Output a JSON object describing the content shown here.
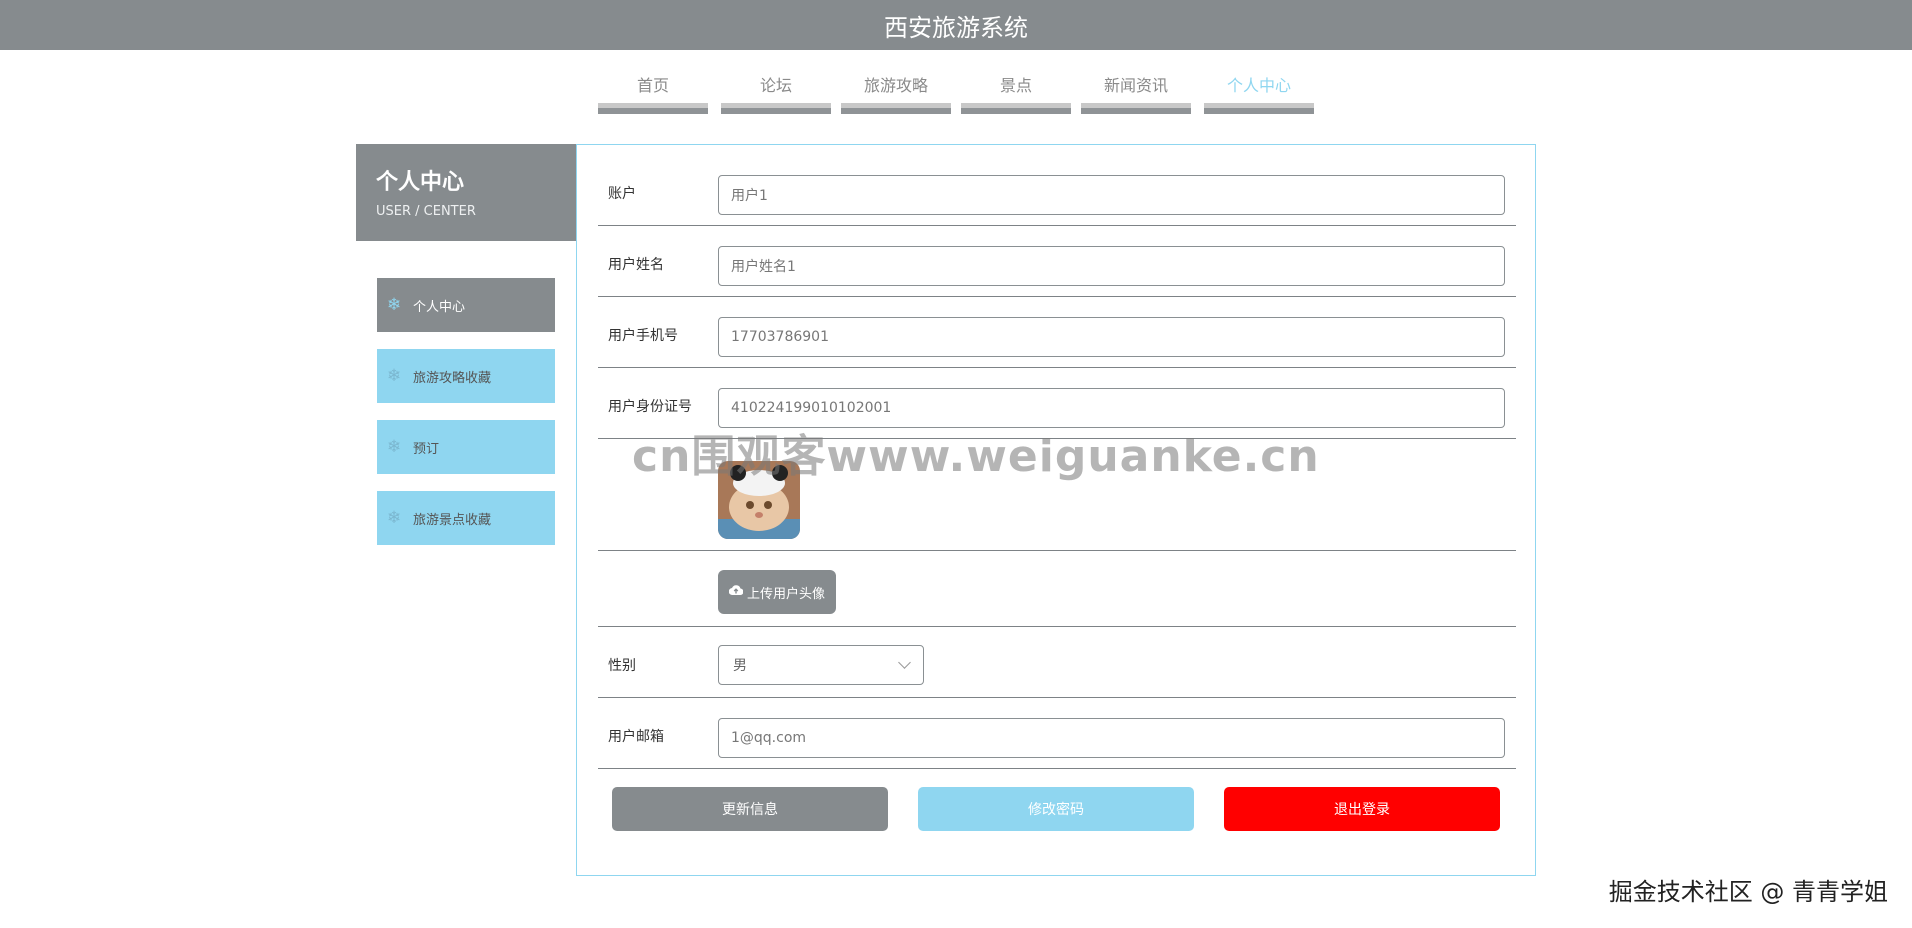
{
  "app": {
    "title": "西安旅游系统"
  },
  "nav": {
    "tabs": [
      {
        "label": "首页"
      },
      {
        "label": "论坛"
      },
      {
        "label": "旅游攻略"
      },
      {
        "label": "景点"
      },
      {
        "label": "新闻资讯"
      },
      {
        "label": "个人中心",
        "active": true
      }
    ]
  },
  "sidebar": {
    "heading": "个人中心",
    "subheading": "USER / CENTER",
    "items": [
      {
        "label": "个人中心",
        "icon": "snowflake-icon",
        "active": true
      },
      {
        "label": "旅游攻略收藏",
        "icon": "snowflake-icon"
      },
      {
        "label": "预订",
        "icon": "snowflake-icon"
      },
      {
        "label": "旅游景点收藏",
        "icon": "snowflake-icon"
      }
    ]
  },
  "form": {
    "account": {
      "label": "账户",
      "value": "用户1"
    },
    "name": {
      "label": "用户姓名",
      "value": "用户姓名1"
    },
    "phone": {
      "label": "用户手机号",
      "value": "17703786901"
    },
    "id_card": {
      "label": "用户身份证号",
      "value": "410224199010102001"
    },
    "avatar": {
      "icon": "avatar-image"
    },
    "upload_label": "上传用户头像",
    "gender": {
      "label": "性别",
      "value": "男"
    },
    "email": {
      "label": "用户邮箱",
      "value": "1@qq.com"
    }
  },
  "actions": {
    "update": "更新信息",
    "change_password": "修改密码",
    "logout": "退出登录"
  },
  "colors": {
    "header_bg": "#868b8e",
    "accent": "#8fd6f0",
    "danger": "#ff0000"
  },
  "watermark": "cn围观客www.weiguanke.cn",
  "credit": "掘金技术社区 @ 青青学姐"
}
